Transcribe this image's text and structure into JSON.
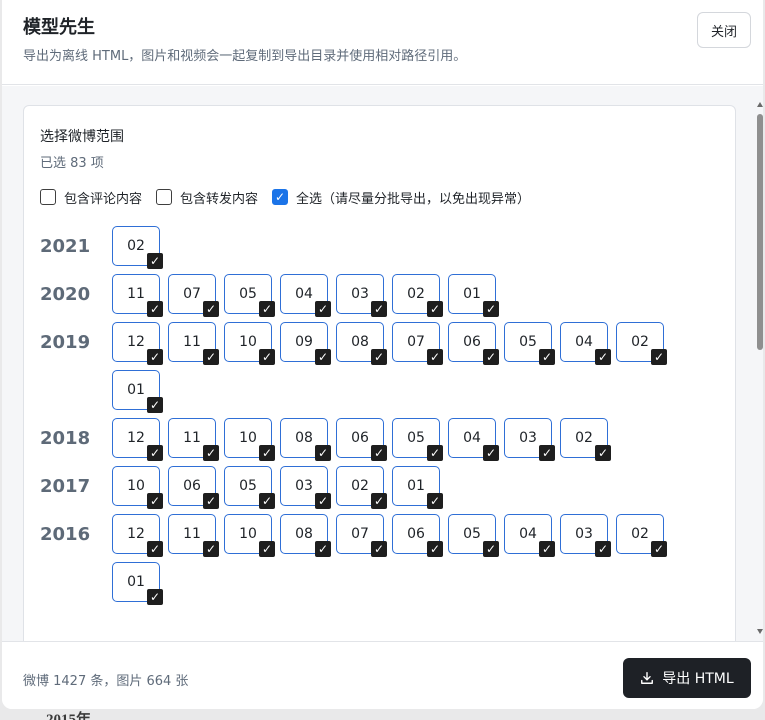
{
  "header": {
    "title": "模型先生",
    "subtitle": "导出为离线 HTML，图片和视频会一起复制到导出目录并使用相对路径引用。",
    "close_label": "关闭"
  },
  "card": {
    "title": "选择微博范围",
    "selected_count": "已选 83 项"
  },
  "options": [
    {
      "label": "包含评论内容",
      "checked": false
    },
    {
      "label": "包含转发内容",
      "checked": false
    },
    {
      "label": "全选（请尽量分批导出，以免出现异常）",
      "checked": true
    }
  ],
  "years": [
    {
      "year": "2021",
      "months": [
        "02"
      ]
    },
    {
      "year": "2020",
      "months": [
        "11",
        "07",
        "05",
        "04",
        "03",
        "02",
        "01"
      ]
    },
    {
      "year": "2019",
      "months": [
        "12",
        "11",
        "10",
        "09",
        "08",
        "07",
        "06",
        "05",
        "04",
        "02",
        "01"
      ]
    },
    {
      "year": "2018",
      "months": [
        "12",
        "11",
        "10",
        "08",
        "06",
        "05",
        "04",
        "03",
        "02"
      ]
    },
    {
      "year": "2017",
      "months": [
        "10",
        "06",
        "05",
        "03",
        "02",
        "01"
      ]
    },
    {
      "year": "2016",
      "months": [
        "12",
        "11",
        "10",
        "08",
        "07",
        "06",
        "05",
        "04",
        "03",
        "02",
        "01"
      ]
    }
  ],
  "footer": {
    "stats": "微博 1427 条，图片 664 张",
    "export_label": "导出 HTML"
  },
  "background_peek": "2015年"
}
